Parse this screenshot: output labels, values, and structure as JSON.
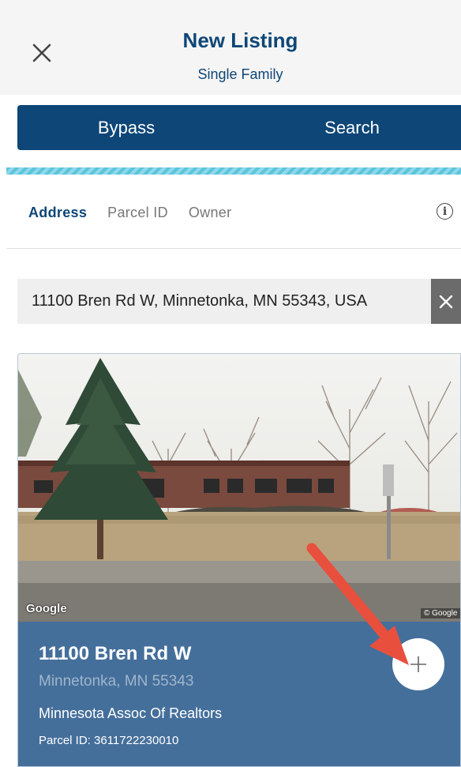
{
  "header": {
    "title": "New Listing",
    "subtitle": "Single Family"
  },
  "segmented": {
    "bypass_label": "Bypass",
    "search_label": "Search"
  },
  "tabs": [
    {
      "label": "Address",
      "active": true
    },
    {
      "label": "Parcel ID",
      "active": false
    },
    {
      "label": "Owner",
      "active": false
    }
  ],
  "search": {
    "value": "11100 Bren Rd W, Minnetonka, MN 55343, USA"
  },
  "result": {
    "photo_watermark": "Google",
    "photo_copyright": "© Google",
    "street": "11100 Bren Rd W",
    "city": "Minnetonka, MN 55343",
    "mls": "Minnesota Assoc Of Realtors",
    "parcel": "Parcel ID: 3611722230010"
  },
  "colors": {
    "brand_navy": "#0d4677",
    "card_blue": "#456f9b",
    "annotation_arrow": "#e8503d"
  },
  "icons": [
    "close-icon",
    "info-icon",
    "clear-icon",
    "plus-icon"
  ]
}
